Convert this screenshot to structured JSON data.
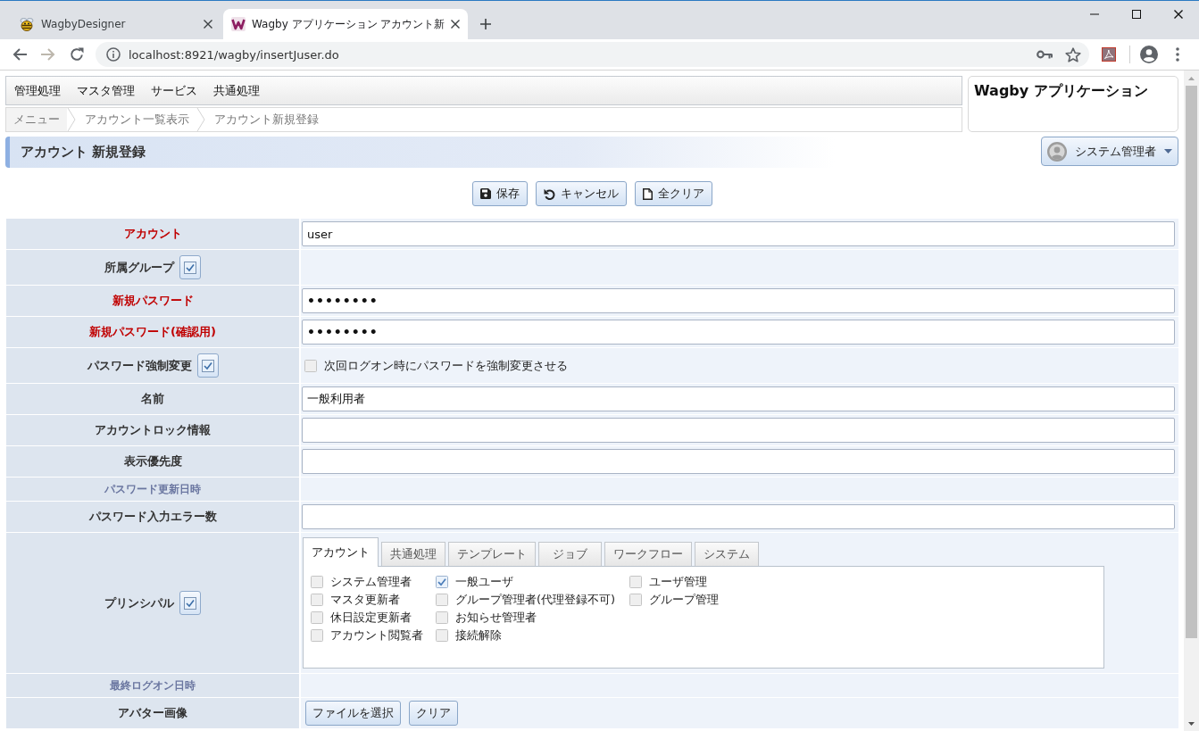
{
  "browser": {
    "tabs": [
      {
        "title": "WagbyDesigner",
        "kind": "bee",
        "selected": false
      },
      {
        "title": "Wagby アプリケーション アカウント新",
        "kind": "logo",
        "selected": true
      }
    ],
    "back_disabled": false,
    "forward_disabled": true,
    "url": "localhost:8921/wagby/insertJuser.do"
  },
  "menu": [
    {
      "label": "管理処理"
    },
    {
      "label": "マスタ管理"
    },
    {
      "label": "サービス"
    },
    {
      "label": "共通処理"
    }
  ],
  "breadcrumb": [
    {
      "label": "メニュー"
    },
    {
      "label": "アカウント一覧表示"
    },
    {
      "label": "アカウント新規登録"
    }
  ],
  "app_title": "Wagby アプリケーション",
  "page_title": "アカウント 新規登録",
  "user_menu": {
    "label": "システム管理者"
  },
  "actions": [
    {
      "label": "保存",
      "kind": "save"
    },
    {
      "label": "キャンセル",
      "kind": "cancel"
    },
    {
      "label": "全クリア",
      "kind": "clear"
    }
  ],
  "form": {
    "rows": [
      {
        "label": "アカウント",
        "required": true,
        "readonly": false,
        "toggle": false,
        "kind": "text",
        "value": "user"
      },
      {
        "label": "所属グループ",
        "required": false,
        "readonly": false,
        "toggle": true,
        "kind": "empty"
      },
      {
        "label": "新規パスワード",
        "required": true,
        "readonly": false,
        "toggle": false,
        "kind": "password",
        "value": "••••••••"
      },
      {
        "label": "新規パスワード(確認用)",
        "required": true,
        "readonly": false,
        "toggle": false,
        "kind": "password",
        "value": "••••••••"
      },
      {
        "label": "パスワード強制変更",
        "required": false,
        "readonly": false,
        "toggle": true,
        "kind": "checkbox",
        "option": {
          "label": "次回ログオン時にパスワードを強制変更させる",
          "checked": false
        }
      },
      {
        "label": "名前",
        "required": false,
        "readonly": false,
        "toggle": false,
        "kind": "text",
        "value": "一般利用者"
      },
      {
        "label": "アカウントロック情報",
        "required": false,
        "readonly": false,
        "toggle": false,
        "kind": "text"
      },
      {
        "label": "表示優先度",
        "required": false,
        "readonly": false,
        "toggle": false,
        "kind": "text"
      },
      {
        "label": "パスワード更新日時",
        "required": false,
        "readonly": true,
        "toggle": false,
        "kind": "empty"
      },
      {
        "label": "パスワード入力エラー数",
        "required": false,
        "readonly": false,
        "toggle": false,
        "kind": "text"
      },
      {
        "label": "プリンシパル",
        "required": false,
        "readonly": false,
        "toggle": true,
        "kind": "tabs",
        "tabs": [
          {
            "label": "アカウント",
            "selected": true
          },
          {
            "label": "共通処理",
            "selected": false
          },
          {
            "label": "テンプレート",
            "selected": false
          },
          {
            "label": "ジョブ",
            "selected": false
          },
          {
            "label": "ワークフロー",
            "selected": false
          },
          {
            "label": "システム",
            "selected": false
          }
        ],
        "columns": [
          {
            "options": [
              {
                "label": "システム管理者",
                "checked": false
              },
              {
                "label": "マスタ更新者",
                "checked": false
              },
              {
                "label": "休日設定更新者",
                "checked": false
              },
              {
                "label": "アカウント閲覧者",
                "checked": false
              }
            ]
          },
          {
            "options": [
              {
                "label": "一般ユーザ",
                "checked": true
              },
              {
                "label": "グループ管理者(代理登録不可)",
                "checked": false
              },
              {
                "label": "お知らせ管理者",
                "checked": false
              },
              {
                "label": "接続解除",
                "checked": false
              }
            ]
          },
          {
            "options": [
              {
                "label": "ユーザ管理",
                "checked": false
              },
              {
                "label": "グループ管理",
                "checked": false
              }
            ]
          }
        ]
      },
      {
        "label": "最終ログオン日時",
        "required": false,
        "readonly": true,
        "toggle": false,
        "kind": "empty"
      },
      {
        "label": "アバター画像",
        "required": false,
        "readonly": false,
        "toggle": false,
        "kind": "file",
        "buttons": [
          {
            "label": "ファイルを選択"
          },
          {
            "label": "クリア"
          }
        ]
      }
    ]
  }
}
